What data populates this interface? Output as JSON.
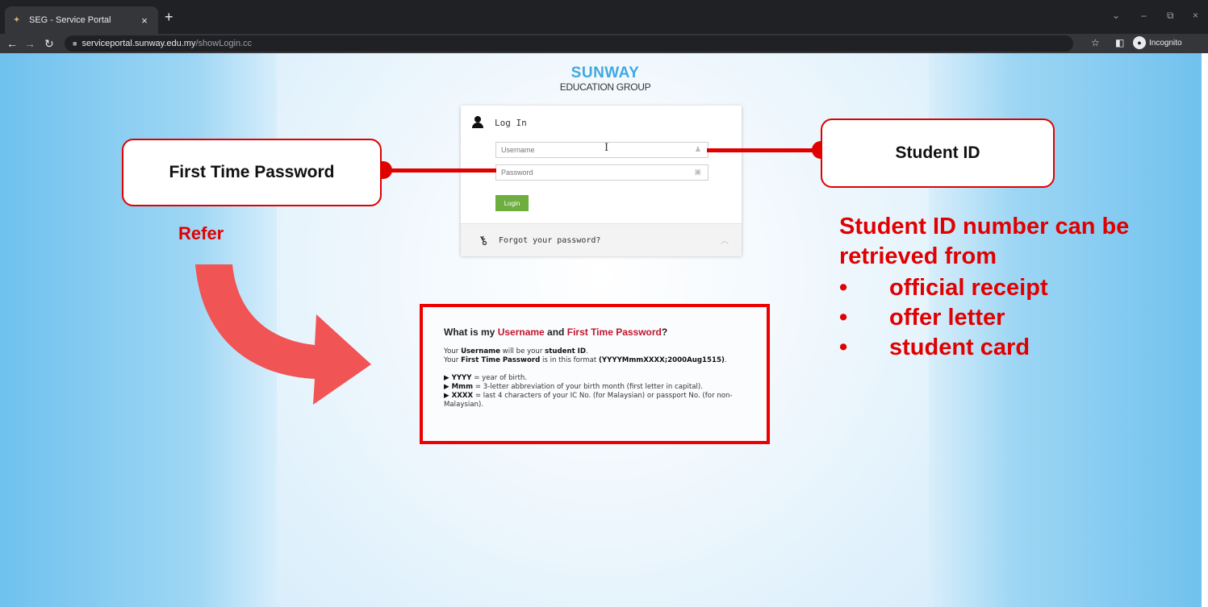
{
  "browser": {
    "tab_title": "SEG - Service Portal",
    "tab_close": "×",
    "new_tab": "+",
    "url_host": "serviceportal.sunway.edu.my",
    "url_path": "/showLogin.cc",
    "incognito_label": "Incognito",
    "window_controls": {
      "menu": "⌄",
      "minimize": "–",
      "restore": "⧉",
      "close": "×"
    }
  },
  "logo": {
    "line1": "SUNWAY",
    "line2": "EDUCATION GROUP"
  },
  "login": {
    "heading": "Log In",
    "username_placeholder": "Username",
    "password_placeholder": "Password",
    "button": "Login",
    "forgot": "Forgot your password?"
  },
  "info": {
    "title_prefix": "What is my ",
    "title_username": "Username",
    "title_and": " and ",
    "title_password": "First Time Password",
    "title_suffix": "?",
    "line1_a": "Your ",
    "line1_b": "Username",
    "line1_c": " will be your ",
    "line1_d": "student ID",
    "line1_e": ".",
    "line2_a": "Your ",
    "line2_b": "First Time Password",
    "line2_c": " is in this format ",
    "line2_d": "(YYYYMmmXXXX;2000Aug1515)",
    "line2_e": ".",
    "b1_key": "▶ YYYY",
    "b1_text": " = year of birth.",
    "b2_key": "▶ Mmm",
    "b2_text": " = 3-letter abbreviation of your birth month (first letter in capital).",
    "b3_key": "▶ XXXX",
    "b3_text": " = last 4 characters of your IC No. (for Malaysian) or passport No. (for non-Malaysian)."
  },
  "annotations": {
    "left_callout": "First Time Password",
    "right_callout": "Student ID",
    "refer": "Refer",
    "side_note": "Student ID number can be retrieved from",
    "bullets": [
      "official receipt",
      "offer letter",
      "student card"
    ],
    "bullet_char": "•"
  },
  "colors": {
    "annotation_red": "#e00000",
    "arrow_red": "#f05454",
    "logo_blue": "#3fa9e0",
    "login_green": "#6dae3f"
  },
  "icons": {
    "favicon": "sunway-favicon-icon",
    "lock": "lock-icon",
    "user": "user-icon",
    "password": "padlock-icon",
    "key": "key-icon",
    "star": "bookmark-star-icon",
    "incognito": "incognito-icon"
  }
}
